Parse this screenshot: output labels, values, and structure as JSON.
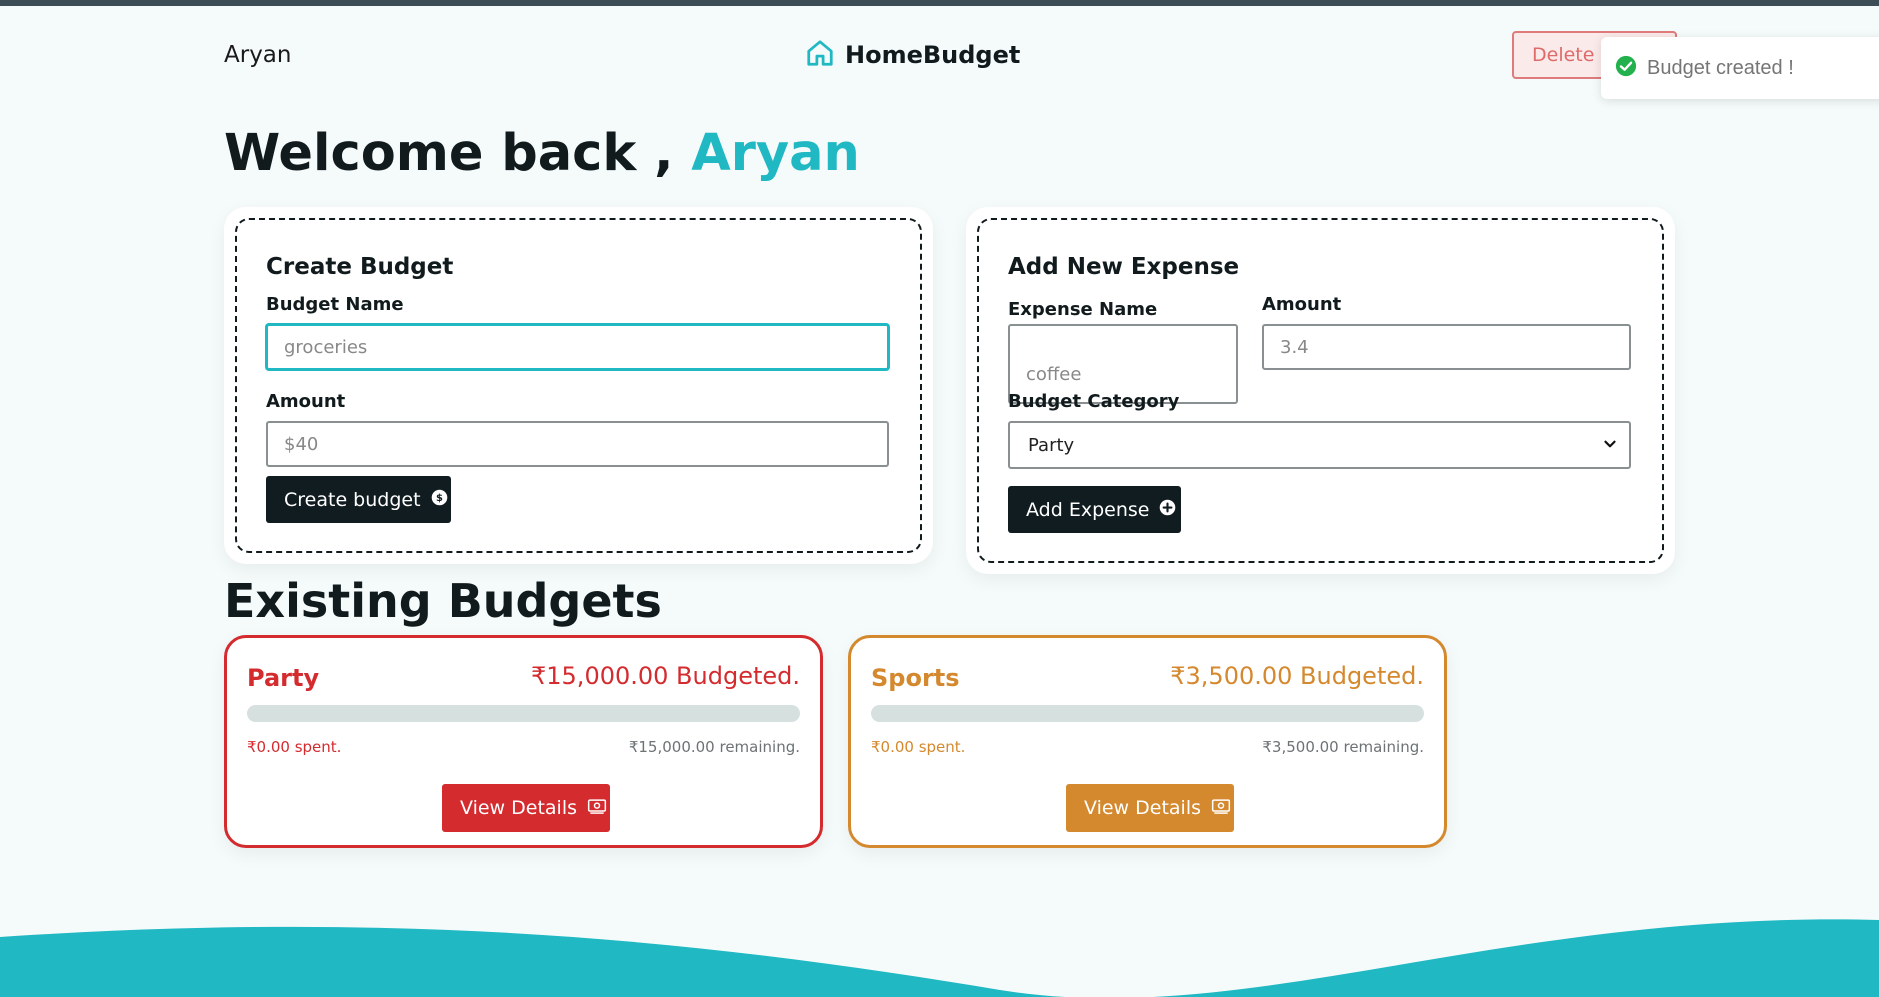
{
  "nav": {
    "user_name": "Aryan",
    "brand": "HomeBudget",
    "delete_button": "Delete User",
    "home_icon": "home-icon"
  },
  "toast": {
    "message": "Budget created !",
    "icon": "check-circle-icon",
    "color": "#22b14c"
  },
  "welcome": {
    "prefix": "Welcome back ,",
    "name": "Aryan"
  },
  "create_budget": {
    "title": "Create Budget",
    "name_label": "Budget Name",
    "name_placeholder": "groceries",
    "amount_label": "Amount",
    "amount_placeholder": "$40",
    "submit_label": "Create budget",
    "submit_icon": "dollar-circle-icon"
  },
  "add_expense": {
    "title": "Add New Expense",
    "name_label": "Expense Name",
    "name_placeholder": "coffee",
    "amount_label": "Amount",
    "amount_placeholder": "3.4",
    "category_label": "Budget Category",
    "category_value": "Party",
    "submit_label": "Add Expense",
    "submit_icon": "plus-circle-icon"
  },
  "existing": {
    "title": "Existing Budgets",
    "budgets": [
      {
        "name": "Party",
        "amount": "₹15,000.00 Budgeted.",
        "spent": "₹0.00 spent.",
        "remaining": "₹15,000.00 remaining.",
        "progress": 0,
        "color": "#d42b2f",
        "button": "View Details",
        "button_icon": "cash-icon"
      },
      {
        "name": "Sports",
        "amount": "₹3,500.00 Budgeted.",
        "spent": "₹0.00 spent.",
        "remaining": "₹3,500.00 remaining.",
        "progress": 0,
        "color": "#d4892e",
        "button": "View Details",
        "button_icon": "cash-icon"
      }
    ]
  },
  "colors": {
    "accent": "#1fb8c3",
    "dark": "#101c1f",
    "background": "#f5fbfb"
  }
}
